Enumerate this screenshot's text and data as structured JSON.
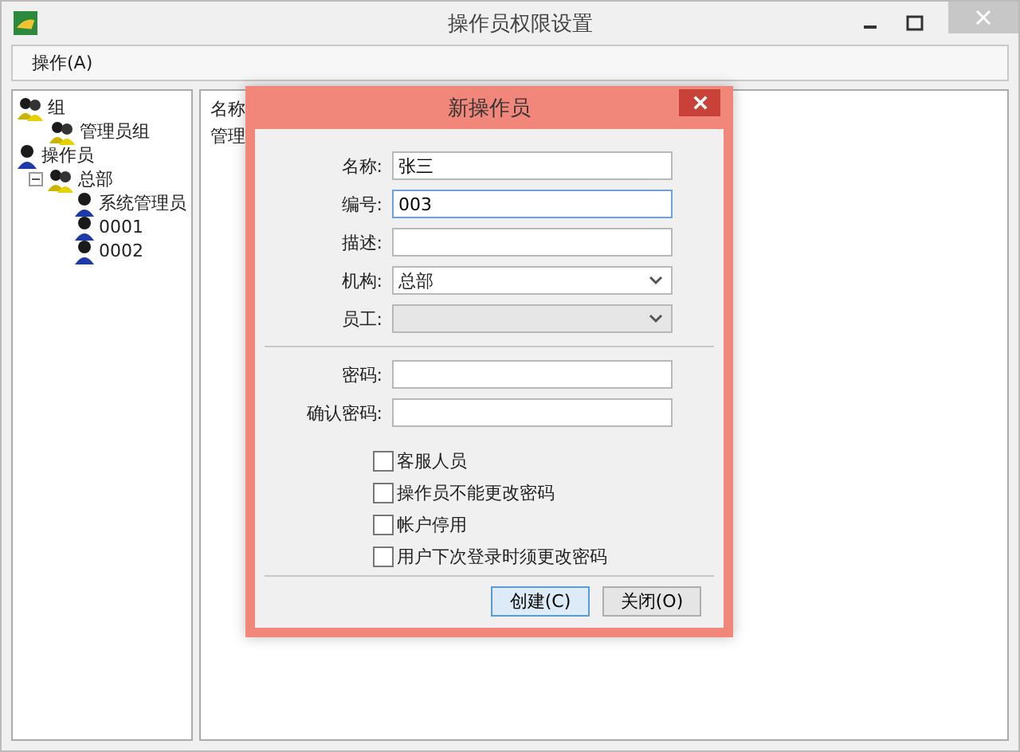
{
  "window": {
    "title": "操作员权限设置"
  },
  "menu": [
    {
      "label": "操作(A)"
    }
  ],
  "tree": [
    {
      "label": "组",
      "kind": "group",
      "children": [
        {
          "label": "管理员组",
          "kind": "group"
        }
      ]
    },
    {
      "label": "操作员",
      "kind": "user",
      "children": [
        {
          "label": "总部",
          "kind": "group",
          "expanded": true,
          "children": [
            {
              "label": "系统管理员",
              "kind": "user"
            },
            {
              "label": "0001",
              "kind": "user"
            },
            {
              "label": "0002",
              "kind": "user"
            }
          ]
        }
      ]
    }
  ],
  "list": {
    "columns": [
      "名称"
    ],
    "rows": [
      "管理"
    ]
  },
  "dialog": {
    "title": "新操作员",
    "fields": [
      {
        "label": "名称:",
        "kind": "text",
        "value": "张三",
        "focused": false
      },
      {
        "label": "编号:",
        "kind": "text",
        "value": "003",
        "focused": true
      },
      {
        "label": "描述:",
        "kind": "text",
        "focused": false
      },
      {
        "label": "机构:",
        "kind": "select",
        "value": "总部",
        "disabled": false
      },
      {
        "label": "员工:",
        "kind": "select",
        "disabled": true
      }
    ],
    "password_fields": [
      {
        "label": "密码:",
        "kind": "text",
        "focused": false
      },
      {
        "label": "确认密码:",
        "kind": "text",
        "focused": false
      }
    ],
    "checkboxes": [
      {
        "label": "客服人员",
        "checked": false
      },
      {
        "label": "操作员不能更改密码",
        "checked": false
      },
      {
        "label": "帐户停用",
        "checked": false
      },
      {
        "label": "用户下次登录时须更改密码",
        "checked": false
      }
    ],
    "buttons": [
      {
        "label": "创建(C)",
        "default": true
      },
      {
        "label": "关闭(O)",
        "default": false
      }
    ]
  }
}
